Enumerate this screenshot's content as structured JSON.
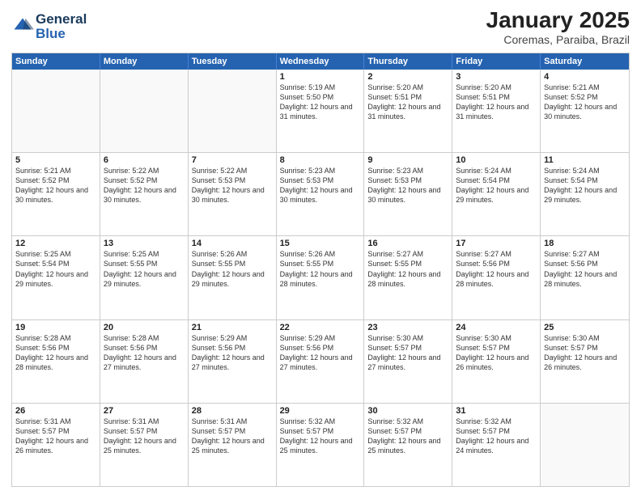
{
  "header": {
    "logo_general": "General",
    "logo_blue": "Blue",
    "title": "January 2025",
    "subtitle": "Coremas, Paraiba, Brazil"
  },
  "calendar": {
    "weekdays": [
      "Sunday",
      "Monday",
      "Tuesday",
      "Wednesday",
      "Thursday",
      "Friday",
      "Saturday"
    ],
    "rows": [
      [
        {
          "day": "",
          "empty": true
        },
        {
          "day": "",
          "empty": true
        },
        {
          "day": "",
          "empty": true
        },
        {
          "day": "1",
          "sunrise": "5:19 AM",
          "sunset": "5:50 PM",
          "daylight": "12 hours and 31 minutes."
        },
        {
          "day": "2",
          "sunrise": "5:20 AM",
          "sunset": "5:51 PM",
          "daylight": "12 hours and 31 minutes."
        },
        {
          "day": "3",
          "sunrise": "5:20 AM",
          "sunset": "5:51 PM",
          "daylight": "12 hours and 31 minutes."
        },
        {
          "day": "4",
          "sunrise": "5:21 AM",
          "sunset": "5:52 PM",
          "daylight": "12 hours and 30 minutes."
        }
      ],
      [
        {
          "day": "5",
          "sunrise": "5:21 AM",
          "sunset": "5:52 PM",
          "daylight": "12 hours and 30 minutes."
        },
        {
          "day": "6",
          "sunrise": "5:22 AM",
          "sunset": "5:52 PM",
          "daylight": "12 hours and 30 minutes."
        },
        {
          "day": "7",
          "sunrise": "5:22 AM",
          "sunset": "5:53 PM",
          "daylight": "12 hours and 30 minutes."
        },
        {
          "day": "8",
          "sunrise": "5:23 AM",
          "sunset": "5:53 PM",
          "daylight": "12 hours and 30 minutes."
        },
        {
          "day": "9",
          "sunrise": "5:23 AM",
          "sunset": "5:53 PM",
          "daylight": "12 hours and 30 minutes."
        },
        {
          "day": "10",
          "sunrise": "5:24 AM",
          "sunset": "5:54 PM",
          "daylight": "12 hours and 29 minutes."
        },
        {
          "day": "11",
          "sunrise": "5:24 AM",
          "sunset": "5:54 PM",
          "daylight": "12 hours and 29 minutes."
        }
      ],
      [
        {
          "day": "12",
          "sunrise": "5:25 AM",
          "sunset": "5:54 PM",
          "daylight": "12 hours and 29 minutes."
        },
        {
          "day": "13",
          "sunrise": "5:25 AM",
          "sunset": "5:55 PM",
          "daylight": "12 hours and 29 minutes."
        },
        {
          "day": "14",
          "sunrise": "5:26 AM",
          "sunset": "5:55 PM",
          "daylight": "12 hours and 29 minutes."
        },
        {
          "day": "15",
          "sunrise": "5:26 AM",
          "sunset": "5:55 PM",
          "daylight": "12 hours and 28 minutes."
        },
        {
          "day": "16",
          "sunrise": "5:27 AM",
          "sunset": "5:55 PM",
          "daylight": "12 hours and 28 minutes."
        },
        {
          "day": "17",
          "sunrise": "5:27 AM",
          "sunset": "5:56 PM",
          "daylight": "12 hours and 28 minutes."
        },
        {
          "day": "18",
          "sunrise": "5:27 AM",
          "sunset": "5:56 PM",
          "daylight": "12 hours and 28 minutes."
        }
      ],
      [
        {
          "day": "19",
          "sunrise": "5:28 AM",
          "sunset": "5:56 PM",
          "daylight": "12 hours and 28 minutes."
        },
        {
          "day": "20",
          "sunrise": "5:28 AM",
          "sunset": "5:56 PM",
          "daylight": "12 hours and 27 minutes."
        },
        {
          "day": "21",
          "sunrise": "5:29 AM",
          "sunset": "5:56 PM",
          "daylight": "12 hours and 27 minutes."
        },
        {
          "day": "22",
          "sunrise": "5:29 AM",
          "sunset": "5:56 PM",
          "daylight": "12 hours and 27 minutes."
        },
        {
          "day": "23",
          "sunrise": "5:30 AM",
          "sunset": "5:57 PM",
          "daylight": "12 hours and 27 minutes."
        },
        {
          "day": "24",
          "sunrise": "5:30 AM",
          "sunset": "5:57 PM",
          "daylight": "12 hours and 26 minutes."
        },
        {
          "day": "25",
          "sunrise": "5:30 AM",
          "sunset": "5:57 PM",
          "daylight": "12 hours and 26 minutes."
        }
      ],
      [
        {
          "day": "26",
          "sunrise": "5:31 AM",
          "sunset": "5:57 PM",
          "daylight": "12 hours and 26 minutes."
        },
        {
          "day": "27",
          "sunrise": "5:31 AM",
          "sunset": "5:57 PM",
          "daylight": "12 hours and 25 minutes."
        },
        {
          "day": "28",
          "sunrise": "5:31 AM",
          "sunset": "5:57 PM",
          "daylight": "12 hours and 25 minutes."
        },
        {
          "day": "29",
          "sunrise": "5:32 AM",
          "sunset": "5:57 PM",
          "daylight": "12 hours and 25 minutes."
        },
        {
          "day": "30",
          "sunrise": "5:32 AM",
          "sunset": "5:57 PM",
          "daylight": "12 hours and 25 minutes."
        },
        {
          "day": "31",
          "sunrise": "5:32 AM",
          "sunset": "5:57 PM",
          "daylight": "12 hours and 24 minutes."
        },
        {
          "day": "",
          "empty": true
        }
      ]
    ]
  }
}
